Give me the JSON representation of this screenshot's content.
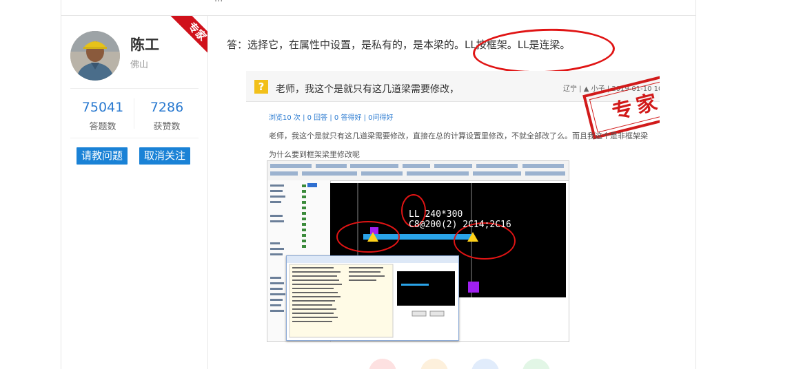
{
  "user": {
    "name": "陈工",
    "city": "佛山",
    "badge": "专家",
    "stats": [
      {
        "value": "75041",
        "label": "答题数"
      },
      {
        "value": "7286",
        "label": "获赞数"
      }
    ],
    "buttons": {
      "ask": "请教问题",
      "unfollow": "取消关注"
    }
  },
  "answer": {
    "text": "答：选择它，在属性中设置，是私有的，是本梁的。LL按框架。LL是连梁。"
  },
  "question": {
    "title": "老师，我这个是就只有这几道梁需要修改，",
    "meta": "辽宁 | ▲ 小子 | 2019-01-10 10:10",
    "stamp": "专家",
    "stats": "浏览10 次 | 0 回答 | 0 答得好 | 0问得好",
    "body_line1": "老师，我这个是就只有这几道梁需要修改，直接在总的计算设置里修改，不就全部改了么。而且我这个是非框架梁",
    "body_line2": "为什么要到框架梁里修改呢"
  },
  "cad": {
    "label_line1": "LL 240*300",
    "label_line2": "C8@200(2) 2C14;2C16"
  },
  "topbar": {
    "ellipsis": "..."
  }
}
